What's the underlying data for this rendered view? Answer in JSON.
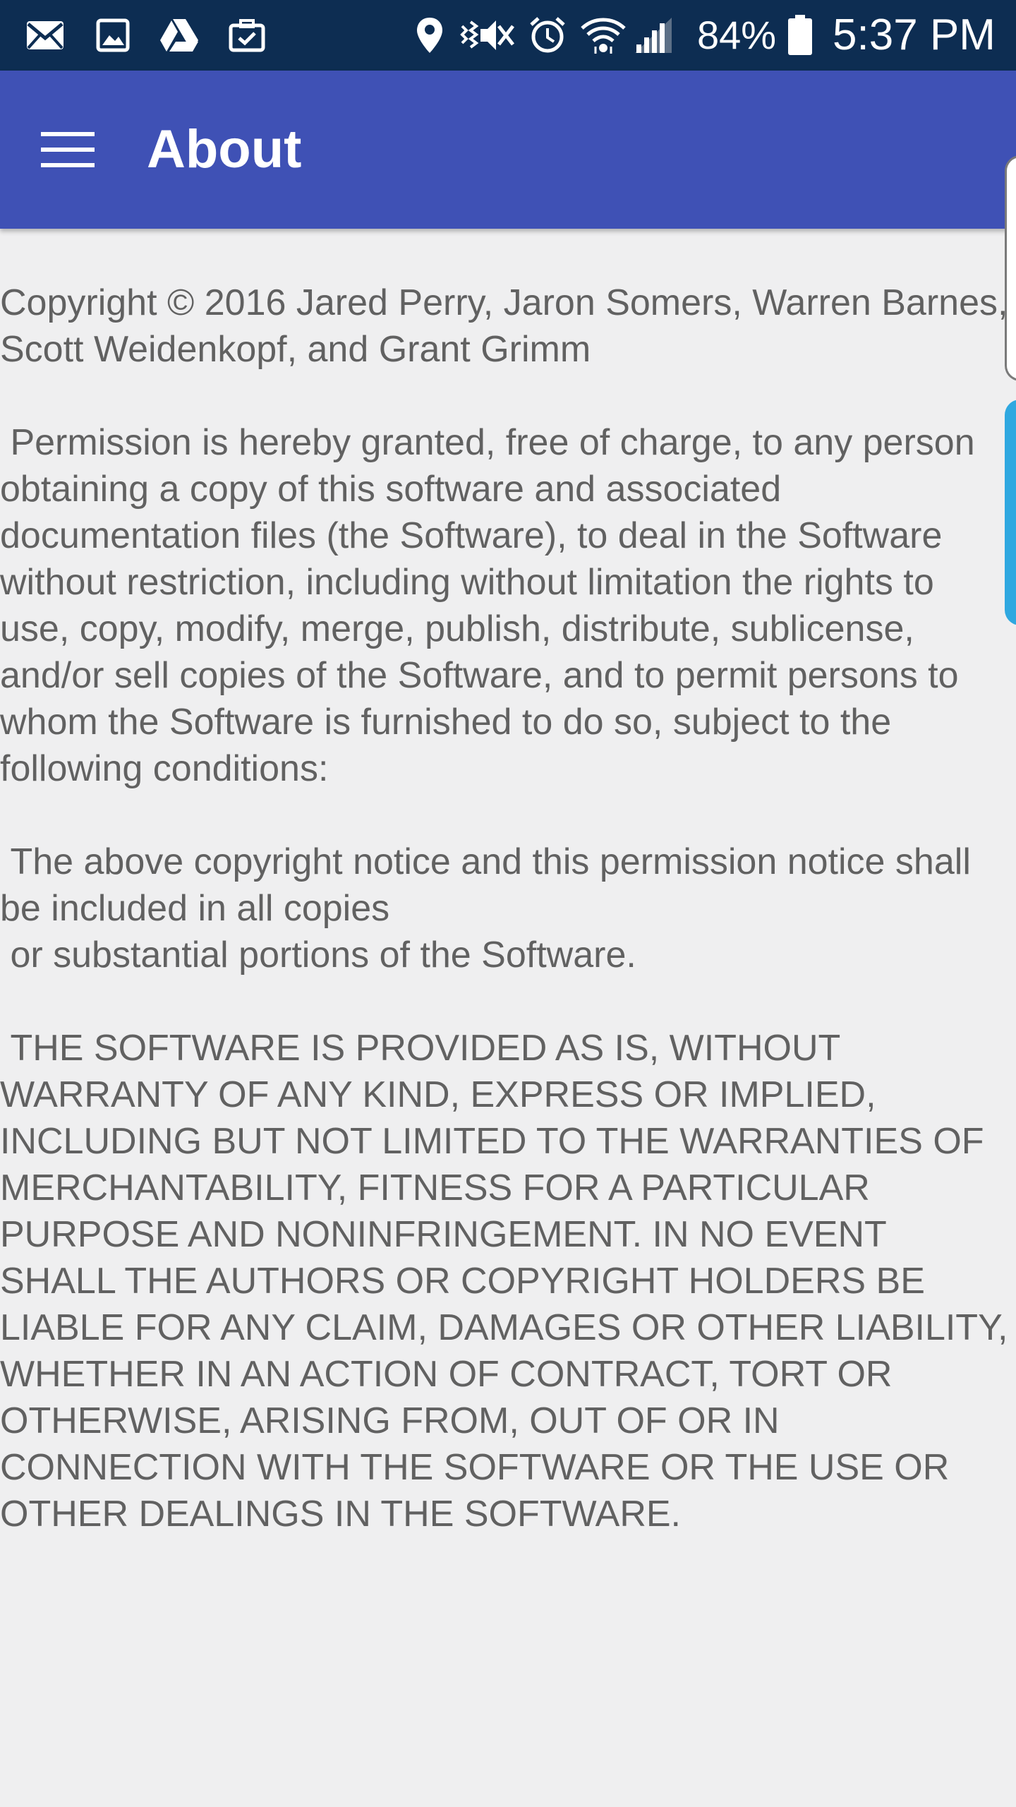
{
  "status_bar": {
    "battery_percent": "84%",
    "time": "5:37 PM",
    "icons": [
      "email-icon",
      "gallery-icon",
      "drive-icon",
      "briefcase-icon",
      "location-icon",
      "vibrate-icon",
      "alarm-icon",
      "wifi-icon",
      "signal-icon",
      "battery-icon"
    ]
  },
  "app_bar": {
    "title": "About",
    "menu_icon": "hamburger-menu-icon",
    "color": "#3f51b5"
  },
  "content": {
    "copyright": "Copyright © 2016 Jared Perry, Jaron Somers, Warren Barnes, Scott Weidenkopf, and Grant Grimm",
    "permission": " Permission is hereby granted, free of charge, to any person obtaining a copy of this software and associated documentation files (the Software), to deal in the Software without restriction, including without limitation the rights to use, copy, modify, merge, publish, distribute, sublicense, and/or sell copies of the Software, and to permit persons to whom the Software is furnished to do so, subject to the following conditions:",
    "notice": " The above copyright notice and this permission notice shall be included in all copies\n or substantial portions of the Software.",
    "warranty": " THE SOFTWARE IS PROVIDED AS IS, WITHOUT WARRANTY OF ANY KIND, EXPRESS OR IMPLIED, INCLUDING BUT NOT LIMITED TO THE WARRANTIES OF MERCHANTABILITY, FITNESS FOR A PARTICULAR PURPOSE AND NONINFRINGEMENT. IN NO EVENT SHALL THE AUTHORS OR COPYRIGHT HOLDERS BE LIABLE FOR ANY CLAIM, DAMAGES OR OTHER LIABILITY, WHETHER IN AN ACTION OF CONTRACT, TORT OR OTHERWISE, ARISING FROM, OUT OF OR IN CONNECTION WITH THE SOFTWARE OR THE USE OR OTHER DEALINGS IN THE SOFTWARE."
  },
  "colors": {
    "status_bar_bg": "#0d2d52",
    "app_bar_bg": "#3f51b5",
    "page_bg": "#efeff0",
    "text": "#616161",
    "edge_handle": "#2fa8e0"
  }
}
